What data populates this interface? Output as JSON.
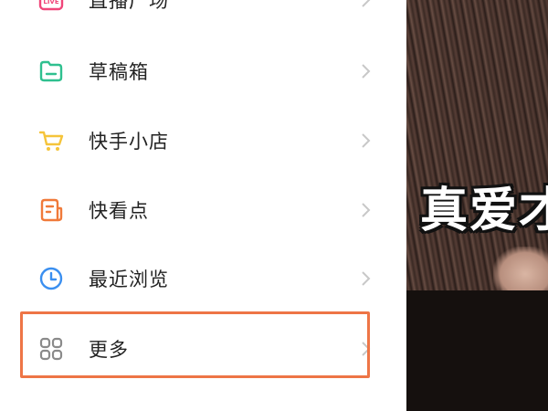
{
  "menu": {
    "items": [
      {
        "label": "直播广场",
        "icon": "live-icon",
        "color": "#f0467a"
      },
      {
        "label": "草稿箱",
        "icon": "folder-icon",
        "color": "#2fc08f"
      },
      {
        "label": "快手小店",
        "icon": "cart-icon",
        "color": "#f5c43a"
      },
      {
        "label": "快看点",
        "icon": "news-icon",
        "color": "#f07a3a"
      },
      {
        "label": "最近浏览",
        "icon": "clock-icon",
        "color": "#3a8ff0"
      },
      {
        "label": "更多",
        "icon": "grid-icon",
        "color": "#777777"
      }
    ],
    "highlight_color": "#ee7546"
  },
  "video": {
    "overlay_text": "真爱才"
  }
}
